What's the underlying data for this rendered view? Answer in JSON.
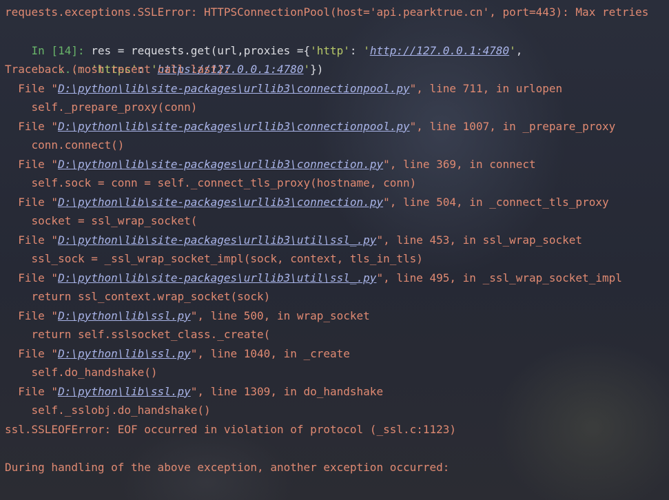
{
  "error_header": "requests.exceptions.SSLError: HTTPSConnectionPool(host='api.pearktrue.cn', port=443): Max retries",
  "input": {
    "prompt": "In [14]: ",
    "code_a": "res = requests.get(url,proxies ={",
    "str_http_key": "'http'",
    "colon_a": ": ",
    "quote_open_a": "'",
    "url_http": "http://127.0.0.1:4780",
    "quote_close_a": "'",
    "comma_a": ",",
    "cont_prompt": "    ...: ",
    "str_https_key": "'https'",
    "colon_b": ": ",
    "quote_open_b": "'",
    "url_https": "https://127.0.0.1:4780",
    "quote_close_b": "'",
    "code_b": "})"
  },
  "traceback_header": "Traceback (most recent call last):",
  "frames": [
    {
      "prefix": "  File \"",
      "path": "D:\\python\\lib\\site-packages\\urllib3\\connectionpool.py",
      "suffix": "\", line 711, in urlopen",
      "code": "    self._prepare_proxy(conn)"
    },
    {
      "prefix": "  File \"",
      "path": "D:\\python\\lib\\site-packages\\urllib3\\connectionpool.py",
      "suffix": "\", line 1007, in _prepare_proxy",
      "code": "    conn.connect()"
    },
    {
      "prefix": "  File \"",
      "path": "D:\\python\\lib\\site-packages\\urllib3\\connection.py",
      "suffix": "\", line 369, in connect",
      "code": "    self.sock = conn = self._connect_tls_proxy(hostname, conn)"
    },
    {
      "prefix": "  File \"",
      "path": "D:\\python\\lib\\site-packages\\urllib3\\connection.py",
      "suffix": "\", line 504, in _connect_tls_proxy",
      "code": "    socket = ssl_wrap_socket("
    },
    {
      "prefix": "  File \"",
      "path": "D:\\python\\lib\\site-packages\\urllib3\\util\\ssl_.py",
      "suffix": "\", line 453, in ssl_wrap_socket",
      "code": "    ssl_sock = _ssl_wrap_socket_impl(sock, context, tls_in_tls)"
    },
    {
      "prefix": "  File \"",
      "path": "D:\\python\\lib\\site-packages\\urllib3\\util\\ssl_.py",
      "suffix": "\", line 495, in _ssl_wrap_socket_impl",
      "code": "    return ssl_context.wrap_socket(sock)"
    },
    {
      "prefix": "  File \"",
      "path": "D:\\python\\lib\\ssl.py",
      "suffix": "\", line 500, in wrap_socket",
      "code": "    return self.sslsocket_class._create("
    },
    {
      "prefix": "  File \"",
      "path": "D:\\python\\lib\\ssl.py",
      "suffix": "\", line 1040, in _create",
      "code": "    self.do_handshake()"
    },
    {
      "prefix": "  File \"",
      "path": "D:\\python\\lib\\ssl.py",
      "suffix": "\", line 1309, in do_handshake",
      "code": "    self._sslobj.do_handshake()"
    }
  ],
  "final_error": "ssl.SSLEOFError: EOF occurred in violation of protocol (_ssl.c:1123)",
  "handling_message": "During handling of the above exception, another exception occurred:"
}
